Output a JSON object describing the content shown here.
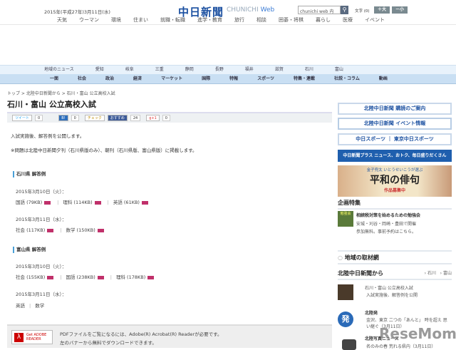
{
  "header": {
    "date": "2015年(平成27年)3月11日(水)",
    "logo": "中日新聞",
    "logo_sub": "CHUNICHI",
    "logo_web": "Web",
    "search_placeholder": "chunichi web 内",
    "search_icon": "search-icon",
    "font_label": "文字 (0)",
    "font_large": "＋大",
    "font_small": "－小"
  },
  "top_nav": [
    "天気",
    "ウーマン",
    "環境",
    "住まい",
    "就職・転職",
    "進学・教育",
    "旅行",
    "相談",
    "囲碁・将棋",
    "暮らし",
    "医療",
    "イベント"
  ],
  "region_nav": [
    "地域のニュース",
    "愛知",
    "岐阜",
    "三重",
    "静岡",
    "長野",
    "福井",
    "滋賀",
    "石川",
    "富山"
  ],
  "category_nav": [
    "一面",
    "社会",
    "政治",
    "経済",
    "マーケット",
    "国際",
    "特報",
    "スポーツ",
    "特集・連載",
    "社説・コラム",
    "動画"
  ],
  "breadcrumb": "トップ > 北陸中日新聞から > 石川・富山 公立高校入試",
  "title": "石川・富山 公立高校入試",
  "social": {
    "tweet": "ツイート",
    "tweet_count": "0",
    "hatena": "B!",
    "hatena_count": "0",
    "check": "チェック",
    "fb": "おすすめ",
    "fb_count": "24",
    "gplus": "g+1",
    "gplus_count": "0"
  },
  "intro": "入試実施後、解答例を公開します。",
  "note": "※問題は北陸中日新聞夕刊（石川県版のみ）、朝刊（石川県版、富山県版）に掲載します。",
  "sections": [
    {
      "heading": "石川県 解答例",
      "days": [
        {
          "date": "2015年3月10日（火）：",
          "items": [
            "国語 (79KB)",
            "理科 (114KB)",
            "英語 (61KB)"
          ],
          "pdf": true
        },
        {
          "date": "2015年3月11日（水）：",
          "items": [
            "社会 (117KB)",
            "数学 (150KB)"
          ],
          "pdf": true
        }
      ]
    },
    {
      "heading": "富山県 解答例",
      "days": [
        {
          "date": "2015年3月10日（火）：",
          "items": [
            "社会 (155KB)",
            "国語 (238KB)",
            "理科 (178KB)"
          ],
          "pdf": true
        },
        {
          "date": "2015年3月11日（水）：",
          "items": [
            "英語",
            "数学"
          ],
          "pdf": false
        }
      ]
    }
  ],
  "adobe": {
    "button": "Get ADOBE READER",
    "line1": "PDFファイルをご覧になるには、Adobe(R) Acrobat(R) Readerが必要です。",
    "line2": "左のバナーから無料でダウンロードできます。"
  },
  "sidebar": {
    "banners": [
      "北陸中日新聞 購読のご案内",
      "北陸中日新聞 イベント情報",
      "中日スポーツ ｜ 東京中日スポーツ",
      "中日新聞プラス ニュース、おトク、毎日盛りだくさん"
    ],
    "haiku": {
      "top": "金子兜太 いとうせいこうが選ぶ",
      "main": "平和の俳句",
      "sub": "作品募集中"
    },
    "kikaku_heading": "企画特集",
    "kikaku": {
      "badge": "勉強会",
      "title": "相続税対策を始めるための勉強会",
      "desc1": "安城・刈谷・岡崎・豊田で開催",
      "desc2": "参加無料。事前予約はこちら。"
    },
    "chiiki": "地域の取材網",
    "hokuriku_heading": "北陸中日新聞から",
    "hokuriku_links": [
      "石川",
      "富山"
    ],
    "items": [
      {
        "title": "石川・富山 公立高校入試",
        "desc": "入試実施後、解答例を公開"
      },
      {
        "title": "北陸発",
        "desc": "金沢、東京 二つの「あんと」 時を超え 思い継ぐ（3月11日）",
        "badge": "発"
      },
      {
        "title": "北陸写真ニュース",
        "desc": "名のみの春 荒れる県内（3月11日）"
      }
    ]
  },
  "watermark": "ReseMom"
}
